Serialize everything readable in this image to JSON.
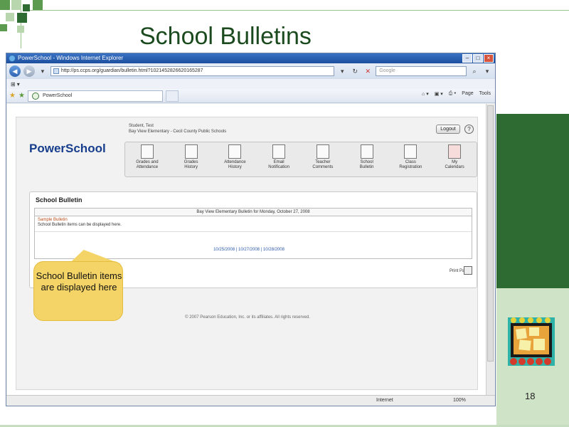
{
  "slide": {
    "title": "School Bulletins",
    "page_number": "18",
    "callout_text": "School Bulletin items are displayed here"
  },
  "browser": {
    "window_title": "PowerSchool - Windows Internet Explorer",
    "url": "http://ps.ccps.org/guardian/bulletin.html?1021452826620165287",
    "search_placeholder": "Google",
    "tab_title": "PowerSchool",
    "command_bar": [
      "Page",
      "Tools"
    ],
    "status_zone": "Internet",
    "zoom": "100%"
  },
  "page": {
    "user_line_1": "Student, Test",
    "user_line_2": "Bay View Elementary - Cecil County Public Schools",
    "logout_label": "Logout",
    "help_icon": "?",
    "logo_text": "PowerSchool",
    "nav_items": [
      {
        "line1": "Grades and",
        "line2": "Attendance"
      },
      {
        "line1": "Grades",
        "line2": "History"
      },
      {
        "line1": "Attendance",
        "line2": "History"
      },
      {
        "line1": "Email",
        "line2": "Notification"
      },
      {
        "line1": "Teacher",
        "line2": "Comments"
      },
      {
        "line1": "School",
        "line2": "Bulletin"
      },
      {
        "line1": "Class",
        "line2": "Registration"
      },
      {
        "line1": "My",
        "line2": "Calendars"
      }
    ],
    "bulletin_heading": "School Bulletin",
    "bulletin_table_header": "Bay View Elementary Bulletin for Monday, October 27, 2008",
    "bulletin_item_title": "Sample Bulletin",
    "bulletin_item_body": "School Bulletin items can be displayed here.",
    "date_links": "10/25/2008 | 10/27/2008 | 10/28/2008",
    "print_label": "Print Page",
    "copyright": "© 2007 Pearson Education, Inc. or its affiliates. All rights reserved."
  }
}
